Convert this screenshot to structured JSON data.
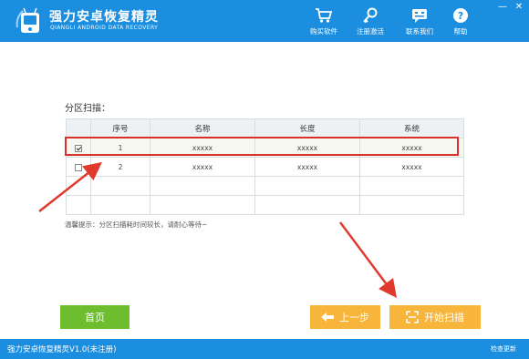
{
  "header": {
    "title": "强力安卓恢复精灵",
    "subtitle": "QIANGLI ANDROID DATA RECOVERY",
    "window_min": "—",
    "window_close": "✕",
    "nav": [
      {
        "label": "购买软件",
        "icon": "cart-icon"
      },
      {
        "label": "注册激活",
        "icon": "key-icon"
      },
      {
        "label": "联系我们",
        "icon": "chat-icon"
      },
      {
        "label": "帮助",
        "icon": "help-icon"
      }
    ]
  },
  "main": {
    "section_label": "分区扫描：",
    "table": {
      "columns": [
        "",
        "序号",
        "名称",
        "长度",
        "系统"
      ],
      "rows": [
        {
          "checked": true,
          "no": "1",
          "name": "xxxxx",
          "length": "xxxxx",
          "system": "xxxxx"
        },
        {
          "checked": false,
          "no": "2",
          "name": "xxxxx",
          "length": "xxxxx",
          "system": "xxxxx"
        }
      ]
    },
    "tip": "温馨提示：分区扫描耗时间较长，请耐心等待~"
  },
  "buttons": {
    "home": "首页",
    "prev": "上一步",
    "start_scan": "开始扫描"
  },
  "statusbar": {
    "text": "强力安卓恢复精灵V1.0(未注册)",
    "update": "检查更新"
  },
  "colors": {
    "brand_blue": "#1b8ee0",
    "home_green": "#6dbd2f",
    "action_orange": "#f7b53b",
    "highlight_red": "#d9302c"
  }
}
